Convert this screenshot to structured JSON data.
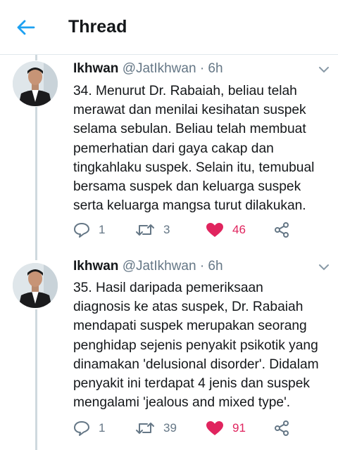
{
  "header": {
    "title": "Thread"
  },
  "colors": {
    "accent": "#1da1f2",
    "like": "#e0245e",
    "muted": "#657786"
  },
  "tweets": [
    {
      "name": "Ikhwan",
      "handle": "@JatIkhwan",
      "time": "· 6h",
      "lines": [
        "34. Menurut Dr. Rabaiah, beliau telah",
        "merawat dan menilai kesihatan suspek",
        "selama sebulan. Beliau telah membuat",
        "pemerhatian dari gaya cakap dan",
        "tingkahlaku suspek. Selain itu, temubual",
        "bersama suspek dan keluarga suspek",
        "serta keluarga mangsa turut dilakukan."
      ],
      "replies": "1",
      "retweets": "3",
      "likes": "46"
    },
    {
      "name": "Ikhwan",
      "handle": "@JatIkhwan",
      "time": "· 6h",
      "lines": [
        "35. Hasil daripada pemeriksaan",
        "diagnosis ke atas suspek, Dr. Rabaiah",
        "mendapati suspek merupakan seorang",
        "penghidap sejenis penyakit psikotik yang",
        "dinamakan 'delusional disorder'. Didalam",
        "penyakit ini terdapat 4 jenis dan suspek",
        "mengalami 'jealous and mixed type'."
      ],
      "replies": "1",
      "retweets": "39",
      "likes": "91"
    }
  ]
}
